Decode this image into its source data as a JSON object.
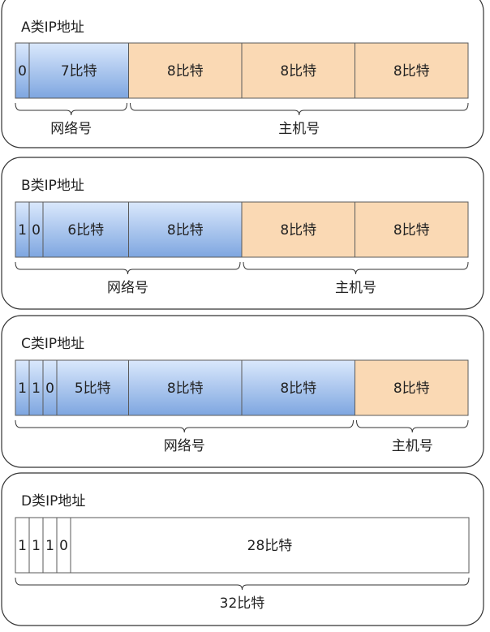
{
  "colors": {
    "network_fill_top": "#dae8fc",
    "network_fill_bottom": "#7ea6e0",
    "host_fill": "#fad9b4",
    "cell_stroke": "#5a5a5a",
    "panel_stroke": "#333333",
    "white": "#ffffff"
  },
  "panels": [
    {
      "title": "A类IP地址",
      "bits": [
        {
          "text": "0",
          "kind": "network"
        }
      ],
      "fields": [
        {
          "text": "7比特",
          "kind": "network"
        },
        {
          "text": "8比特",
          "kind": "host"
        },
        {
          "text": "8比特",
          "kind": "host"
        },
        {
          "text": "8比特",
          "kind": "host"
        }
      ],
      "braces": [
        {
          "label": "网络号",
          "from_field": 0,
          "to_field": 0,
          "include_bits": true
        },
        {
          "label": "主机号",
          "from_field": 1,
          "to_field": 3,
          "include_bits": false
        }
      ]
    },
    {
      "title": "B类IP地址",
      "bits": [
        {
          "text": "1",
          "kind": "network"
        },
        {
          "text": "0",
          "kind": "network"
        }
      ],
      "fields": [
        {
          "text": "6比特",
          "kind": "network"
        },
        {
          "text": "8比特",
          "kind": "network"
        },
        {
          "text": "8比特",
          "kind": "host"
        },
        {
          "text": "8比特",
          "kind": "host"
        }
      ],
      "braces": [
        {
          "label": "网络号",
          "from_field": 0,
          "to_field": 1,
          "include_bits": true
        },
        {
          "label": "主机号",
          "from_field": 2,
          "to_field": 3,
          "include_bits": false
        }
      ]
    },
    {
      "title": "C类IP地址",
      "bits": [
        {
          "text": "1",
          "kind": "network"
        },
        {
          "text": "1",
          "kind": "network"
        },
        {
          "text": "0",
          "kind": "network"
        }
      ],
      "fields": [
        {
          "text": "5比特",
          "kind": "network"
        },
        {
          "text": "8比特",
          "kind": "network"
        },
        {
          "text": "8比特",
          "kind": "network"
        },
        {
          "text": "8比特",
          "kind": "host"
        }
      ],
      "braces": [
        {
          "label": "网络号",
          "from_field": 0,
          "to_field": 2,
          "include_bits": true
        },
        {
          "label": "主机号",
          "from_field": 3,
          "to_field": 3,
          "include_bits": false
        }
      ]
    },
    {
      "title": "D类IP地址",
      "bits": [
        {
          "text": "1",
          "kind": "white"
        },
        {
          "text": "1",
          "kind": "white"
        },
        {
          "text": "1",
          "kind": "white"
        },
        {
          "text": "0",
          "kind": "white"
        }
      ],
      "fields": [
        {
          "text": "28比特",
          "kind": "white",
          "span": 4
        }
      ],
      "braces": [
        {
          "label": "32比特",
          "from_field": 0,
          "to_field": 0,
          "include_bits": true
        }
      ]
    }
  ]
}
